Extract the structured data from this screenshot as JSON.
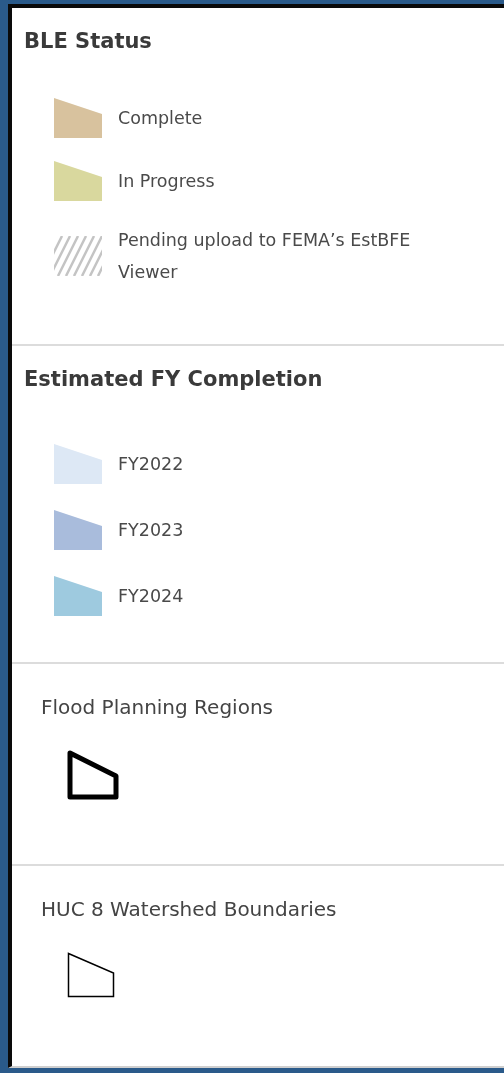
{
  "legend": [
    {
      "kind": "group",
      "title": "BLE Status",
      "items": [
        {
          "kind": "fill",
          "color": "#d8c29e",
          "label": "Complete"
        },
        {
          "kind": "fill",
          "color": "#d9d89e",
          "label": "In Progress"
        },
        {
          "kind": "hatch",
          "color": "#c4c4c4",
          "label": "Pending upload to FEMA’s EstBFE Viewer"
        }
      ]
    },
    {
      "kind": "group",
      "title": "Estimated FY Completion",
      "items": [
        {
          "kind": "fill",
          "color": "#dde8f5",
          "label": "FY2022"
        },
        {
          "kind": "fill",
          "color": "#a9bcdc",
          "label": "FY2023"
        },
        {
          "kind": "fill",
          "color": "#9ecadf",
          "label": "FY2024"
        }
      ]
    },
    {
      "kind": "layer",
      "title": "Flood Planning Regions",
      "items": [
        {
          "kind": "bold-outline",
          "color": "#000000"
        }
      ]
    },
    {
      "kind": "layer",
      "title": "HUC 8 Watershed Boundaries",
      "items": [
        {
          "kind": "outline",
          "color": "#000000"
        }
      ]
    }
  ]
}
